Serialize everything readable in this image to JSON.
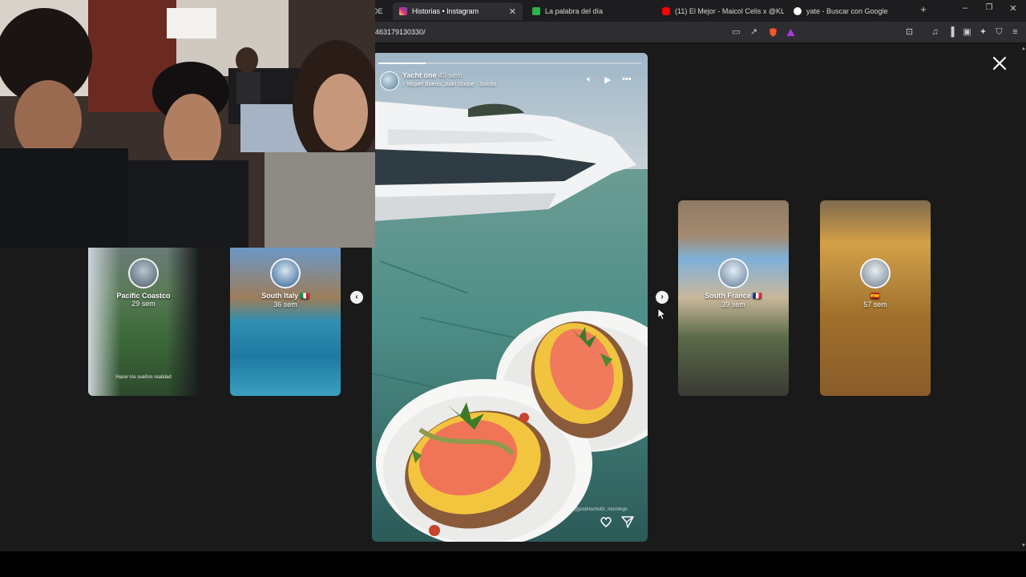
{
  "browser": {
    "tabs": [
      {
        "label": "DE",
        "favicon_color": "#4a4a4a",
        "active": false
      },
      {
        "label": "Historias • Instagram",
        "favicon_color": "#d62976",
        "active": true
      },
      {
        "label": "La palabra del día",
        "favicon_color": "#2bb24c",
        "active": false
      },
      {
        "label": "(11) El Mejor - Maicol Celis x @KLLH",
        "favicon_color": "#ff0000",
        "active": false
      },
      {
        "label": "yate - Buscar con Google",
        "favicon_color": "#ffffff",
        "active": false
      }
    ],
    "url": "463179130330/",
    "new_tab_icon": "plus-icon",
    "window_controls": [
      "minimize-icon",
      "restore-icon",
      "close-icon"
    ]
  },
  "stories": {
    "left_cards": [
      {
        "name": "Pacific Coastco",
        "time": "29 sem",
        "caption": "Hacer los sueños realidad"
      },
      {
        "name": "South Italy 🇮🇹",
        "time": "36 sem",
        "caption": ""
      }
    ],
    "right_cards": [
      {
        "name": "South France 🇫🇷",
        "time": "39 sem"
      },
      {
        "name": "🇪🇸",
        "time": "57 sem"
      }
    ],
    "main": {
      "username": "Yacht one",
      "time": "49 sem",
      "music": "Miquel Bueno, Juan Duque · Solcito",
      "watermark": "@justinscholtz_mornings",
      "progress": 0.18,
      "segments": 20
    },
    "close_icon": "close-x-icon",
    "prev_icon": "chevron-left-icon",
    "next_icon": "chevron-right-icon"
  },
  "colors": {
    "page_bg": "#1a1a1a",
    "tab_bar": "#1d1d1f",
    "address_bar": "#2e2e32",
    "instagram_accent": "#d62976"
  }
}
